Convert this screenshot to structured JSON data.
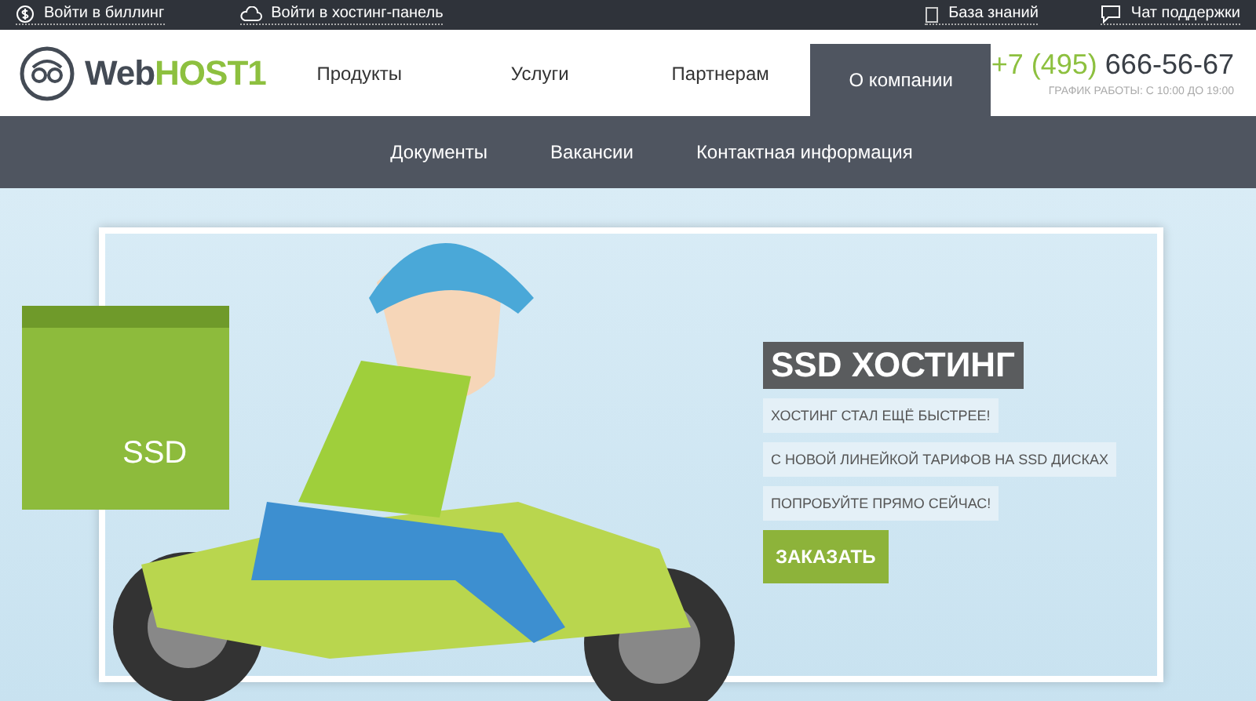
{
  "top_bar": {
    "left_links": [
      {
        "label": "Войти в биллинг",
        "kind": "dollar"
      },
      {
        "label": "Войти в хостинг-панель",
        "kind": "cloud"
      }
    ],
    "right_links": [
      {
        "label": "База знаний",
        "kind": "book"
      },
      {
        "label": "Чат поддержки",
        "kind": "chat"
      }
    ]
  },
  "header": {
    "logo": {
      "part_1": "Web",
      "part_2": "HOST1"
    },
    "nav": [
      {
        "label": "Продукты",
        "selected": false
      },
      {
        "label": "Услуги",
        "selected": false
      },
      {
        "label": "Партнерам",
        "selected": false
      },
      {
        "label": "О компании",
        "selected": true
      }
    ],
    "phone": {
      "code": "+7 (495)",
      "number": "666-56-67"
    },
    "hours": "ГРАФИК РАБОТЫ: С 10:00 ДО 19:00"
  },
  "sub_nav": [
    "Документы",
    "Вакансии",
    "Контактная информация"
  ],
  "hero": {
    "box_label": "SSD",
    "title": "SSD ХОСТИНГ",
    "lines": [
      "ХОСТИНГ СТАЛ ЕЩЁ БЫСТРЕЕ!",
      "С НОВОЙ ЛИНЕЙКОЙ ТАРИФОВ НА SSD ДИСКАХ",
      "ПОПРОБУЙТЕ ПРЯМО СЕЙЧАС!"
    ],
    "button": "ЗАКАЗАТЬ"
  }
}
